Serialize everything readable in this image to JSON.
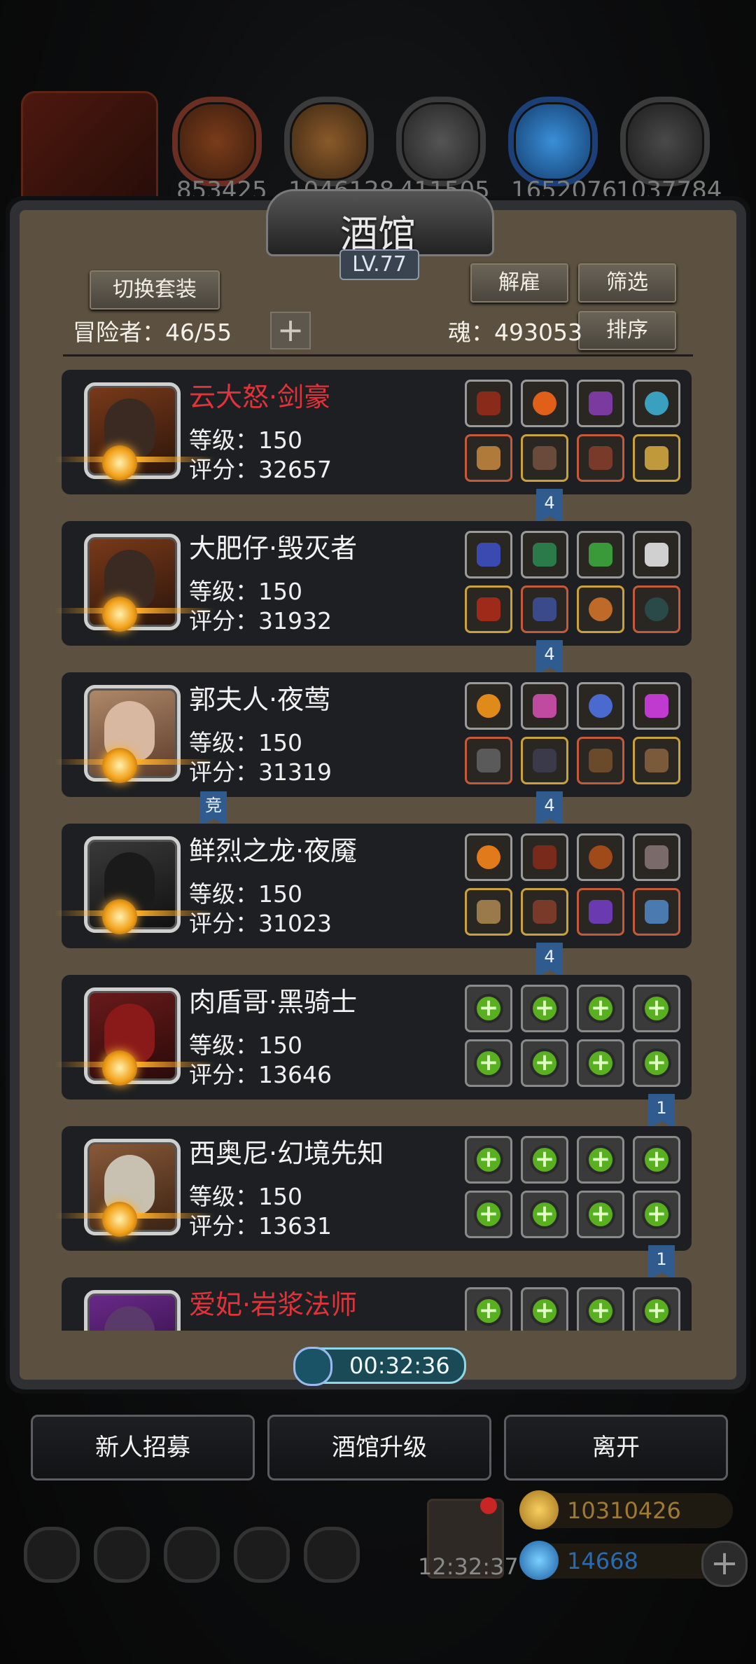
{
  "top_resources": [
    "853425",
    "1046128",
    "411505",
    "1652076",
    "1037784"
  ],
  "title": "酒馆",
  "level": "LV.77",
  "buttons": {
    "switch_set": "切换套装",
    "dismiss": "解雇",
    "filter": "筛选",
    "sort": "排序",
    "add": "+"
  },
  "adventurers": {
    "label": "冒险者：",
    "value": "46/55"
  },
  "soul": {
    "label": "魂：",
    "value": "493053"
  },
  "heroes": [
    {
      "name": "云大怒·剑豪",
      "red": true,
      "level": "等级：150",
      "score": "评分：32657",
      "tag": "4"
    },
    {
      "name": "大肥仔·毁灭者",
      "red": false,
      "level": "等级：150",
      "score": "评分：31932",
      "tag": "4"
    },
    {
      "name": "郭夫人·夜莺",
      "red": false,
      "level": "等级：150",
      "score": "评分：31319",
      "tag": "4",
      "tag2": "竞"
    },
    {
      "name": "鲜烈之龙·夜魇",
      "red": false,
      "level": "等级：150",
      "score": "评分：31023",
      "tag": "4"
    },
    {
      "name": "肉盾哥·黑骑士",
      "red": false,
      "level": "等级：150",
      "score": "评分：13646",
      "tag": "1"
    },
    {
      "name": "西奥尼·幻境先知",
      "red": false,
      "level": "等级：150",
      "score": "评分：13631",
      "tag": "1"
    },
    {
      "name": "爱妃·岩浆法师",
      "red": true
    }
  ],
  "timer": "00:32:36",
  "bottom_buttons": {
    "recruit": "新人招募",
    "upgrade": "酒馆升级",
    "leave": "离开"
  },
  "clock": "12:32:37",
  "gold": "10310426",
  "diamond": "14668"
}
